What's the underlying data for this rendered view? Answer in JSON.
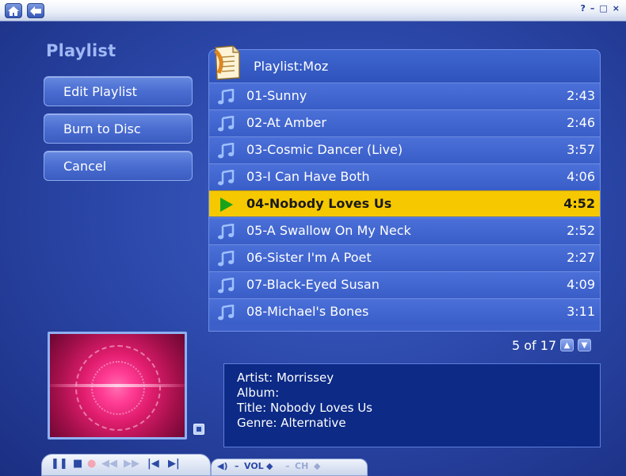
{
  "heading": "Playlist",
  "buttons": {
    "edit_playlist": "Edit Playlist",
    "burn_to_disc": "Burn to Disc",
    "cancel": "Cancel"
  },
  "playlist": {
    "title": "Playlist:Moz",
    "tracks": [
      {
        "name": "01-Sunny",
        "duration": "2:43"
      },
      {
        "name": "02-At Amber",
        "duration": "2:46"
      },
      {
        "name": "03-Cosmic Dancer (Live)",
        "duration": "3:57"
      },
      {
        "name": "03-I Can Have Both",
        "duration": "4:06"
      },
      {
        "name": "04-Nobody Loves Us",
        "duration": "4:52"
      },
      {
        "name": "05-A Swallow On My Neck",
        "duration": "2:52"
      },
      {
        "name": "06-Sister I'm A Poet",
        "duration": "2:27"
      },
      {
        "name": "07-Black-Eyed Susan",
        "duration": "4:09"
      },
      {
        "name": "08-Michael's Bones",
        "duration": "3:11"
      }
    ],
    "active_index": 4,
    "pager": "5 of 17"
  },
  "info": {
    "artist": "Artist: Morrissey",
    "album": "Album:",
    "title": "Title: Nobody Loves Us",
    "genre": "Genre: Alternative"
  },
  "transport": {
    "vol_label": "VOL",
    "ch_label": "CH"
  },
  "colors": {
    "background": "#2c49ab",
    "highlight": "#f6c800",
    "info_panel": "#0c2a86",
    "play_arrow": "#1aa31a"
  },
  "icons": [
    "home-icon",
    "back-icon",
    "help-icon",
    "minimize-icon",
    "maximize-icon",
    "close-icon",
    "playlist-document-icon",
    "music-note-icon",
    "play-arrow-icon",
    "chevron-up-icon",
    "chevron-down-icon",
    "visualization-toggle-icon",
    "pause-icon",
    "stop-icon",
    "record-icon",
    "rewind-icon",
    "fast-forward-icon",
    "skip-back-icon",
    "skip-forward-icon",
    "speaker-icon"
  ]
}
